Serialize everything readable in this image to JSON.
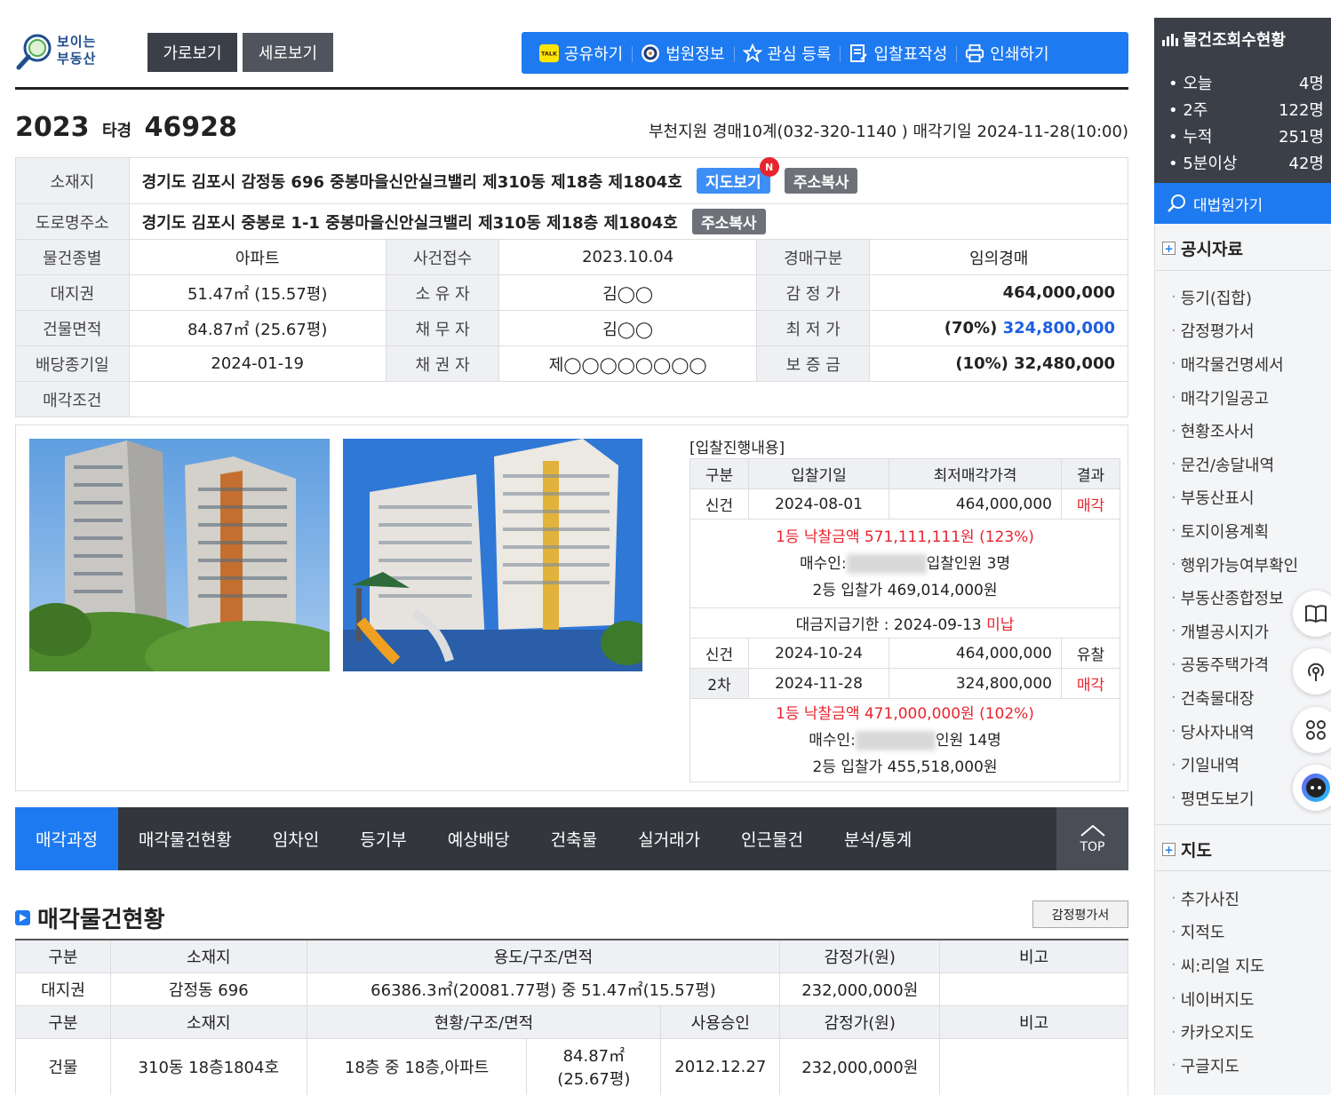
{
  "logo": {
    "text_line1": "보이는",
    "text_line2": "부동산"
  },
  "view_buttons": {
    "horizontal": "가로보기",
    "vertical": "세로보기"
  },
  "toolbar": {
    "share": "공유하기",
    "court_info": "법원정보",
    "favorite": "관심 등록",
    "bid_form": "입찰표작성",
    "print": "인쇄하기"
  },
  "case": {
    "year": "2023",
    "type": "타경",
    "number": "46928",
    "court_info": "부천지원 경매10계(032-320-1140 ) 매각기일 2024-11-28(10:00)"
  },
  "info": {
    "address_label": "소재지",
    "address": "경기도 김포시 감정동 696 중봉마을신안실크밸리 제310동 제18층 제1804호",
    "map_btn": "지도보기",
    "new_badge": "N",
    "copy_btn": "주소복사",
    "road_label": "도로명주소",
    "road_address": "경기도 김포시 중봉로 1-1 중봉마을신안실크밸리 제310동 제18층 제1804호",
    "rows": [
      [
        "물건종별",
        "아파트",
        "사건접수",
        "2023.10.04",
        "경매구분",
        "임의경매"
      ],
      [
        "대지권",
        "51.47㎡ (15.57평)",
        "소 유 자",
        "김◯◯",
        "감 정 가",
        "464,000,000"
      ],
      [
        "건물면적",
        "84.87㎡ (25.67평)",
        "채 무 자",
        "김◯◯",
        "최 저 가",
        ""
      ],
      [
        "배당종기일",
        "2024-01-19",
        "채 권 자",
        "제◯◯◯◯◯◯◯◯",
        "보 증 금",
        "(10%) 32,480,000"
      ]
    ],
    "min_price_pct": "(70%)",
    "min_price": "324,800,000",
    "sale_cond_label": "매각조건"
  },
  "bid": {
    "title": "[입찰진행내용]",
    "headers": [
      "구분",
      "입찰기일",
      "최저매각가격",
      "결과"
    ],
    "row1": [
      "신건",
      "2024-08-01",
      "464,000,000",
      "매각"
    ],
    "win1": "1등 낙찰금액 571,111,111원 (123%)",
    "buyer1_prefix": "매수인:",
    "buyer1_suffix": "입찰인원 3명",
    "second1": "2등 입찰가 469,014,000원",
    "payment": "대금지급기한 : 2024-09-13",
    "payment_status": "미납",
    "row2": [
      "신건",
      "2024-10-24",
      "464,000,000",
      "유찰"
    ],
    "row3": [
      "2차",
      "2024-11-28",
      "324,800,000",
      "매각"
    ],
    "win2": "1등 낙찰금액 471,000,000원 (102%)",
    "buyer2_prefix": "매수인:",
    "buyer2_suffix": "인원 14명",
    "second2": "2등 입찰가 455,518,000원"
  },
  "tabs": [
    "매각과정",
    "매각물건현황",
    "임차인",
    "등기부",
    "예상배당",
    "건축물",
    "실거래가",
    "인근물건",
    "분석/통계"
  ],
  "top_label": "TOP",
  "section": {
    "title": "매각물건현황",
    "appraisal_btn": "감정평가서",
    "land_headers": [
      "구분",
      "소재지",
      "용도/구조/면적",
      "감정가(원)",
      "비고"
    ],
    "land_row": [
      "대지권",
      "감정동 696",
      "66386.3㎡(20081.77평) 중 51.47㎡(15.57평)",
      "232,000,000원",
      ""
    ],
    "bldg_headers": [
      "구분",
      "소재지",
      "현황/구조/면적",
      "사용승인",
      "감정가(원)",
      "비고"
    ],
    "bldg_row": [
      "건물",
      "310동 18층1804호",
      "18층 중 18층,아파트",
      "84.87㎡",
      "(25.67평)",
      "2012.12.27",
      "232,000,000원",
      ""
    ]
  },
  "sidebar": {
    "title": "물건조회수현황",
    "stats": [
      {
        "label": "오늘",
        "value": "4명"
      },
      {
        "label": "2주",
        "value": "122명"
      },
      {
        "label": "누적",
        "value": "251명"
      },
      {
        "label": "5분이상",
        "value": "42명"
      }
    ],
    "court_link": "대법원가기",
    "section1": "공시자료",
    "docs": [
      "등기(집합)",
      "감정평가서",
      "매각물건명세서",
      "매각기일공고",
      "현황조사서",
      "문건/송달내역",
      "부동산표시",
      "토지이용계획",
      "행위가능여부확인",
      "부동산종합정보",
      "개별공시지가",
      "공동주택가격",
      "건축물대장",
      "당사자내역",
      "기일내역",
      "평면도보기"
    ],
    "section2": "지도",
    "maps": [
      "추가사진",
      "지적도",
      "씨:리얼 지도",
      "네이버지도",
      "카카오지도",
      "구글지도"
    ]
  },
  "colors": {
    "accent": "#1e7af0",
    "dark": "#34363d",
    "red": "#e8242f"
  }
}
